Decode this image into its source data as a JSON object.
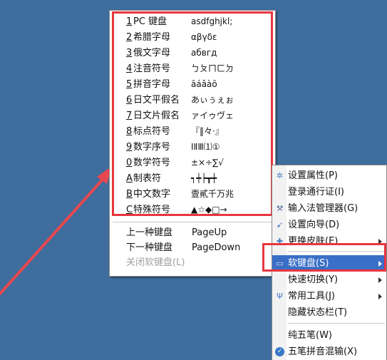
{
  "keyboard_menu": {
    "layouts": [
      {
        "key": "1",
        "label": "PC 键盘",
        "sample": "asdfghjkl;"
      },
      {
        "key": "2",
        "label": "希腊字母",
        "sample": "αβγδε"
      },
      {
        "key": "3",
        "label": "俄文字母",
        "sample": "абвгд"
      },
      {
        "key": "4",
        "label": "注音符号",
        "sample": "ㄅㄆㄇㄈㄉ"
      },
      {
        "key": "5",
        "label": "拼音字母",
        "sample": "āáǎàō"
      },
      {
        "key": "6",
        "label": "日文平假名",
        "sample": "あぃぅぇぉ"
      },
      {
        "key": "7",
        "label": "日文片假名",
        "sample": "ァイゥヴェ"
      },
      {
        "key": "8",
        "label": "标点符号",
        "sample": "『‖々·』"
      },
      {
        "key": "9",
        "label": "数字序号",
        "sample": "ⅠⅡⅢ⑴①"
      },
      {
        "key": "0",
        "label": "数学符号",
        "sample": "±×÷∑√"
      },
      {
        "key": "A",
        "label": "制表符",
        "sample": "┑┿┝┳┿"
      },
      {
        "key": "B",
        "label": "中文数字",
        "sample": "壹貳千万兆"
      },
      {
        "key": "C",
        "label": "特殊符号",
        "sample": "▲☆◆□→"
      }
    ],
    "commands": [
      {
        "label": "上一种键盘",
        "shortcut": "PageUp"
      },
      {
        "label": "下一种键盘",
        "shortcut": "PageDown"
      },
      {
        "label": "关闭软键盘(L)"
      }
    ]
  },
  "context_menu": {
    "items": [
      {
        "label": "设置属性(P)",
        "icon": "gear-icon"
      },
      {
        "label": "登录通行证(I)"
      },
      {
        "label": "输入法管理器(G)",
        "icon": "tools-icon"
      },
      {
        "label": "设置向导(D)",
        "icon": "wizard-icon"
      },
      {
        "label": "更换皮肤(E)",
        "icon": "skin-icon"
      },
      {
        "label": "软键盘(S)",
        "icon": "keyboard-icon"
      },
      {
        "label": "快速切换(Y)"
      },
      {
        "label": "常用工具(J)",
        "icon": "wrench-icon"
      },
      {
        "label": "隐藏状态栏(T)"
      },
      {
        "label": "纯五笔(W)"
      },
      {
        "label": "五笔拼音混输(X)",
        "icon": "check-icon"
      }
    ]
  },
  "colors": {
    "desktop": "#3f6d9d",
    "highlight_border": "#e8363f",
    "selection": "#3a6fc7",
    "arrow": "#e8474f"
  }
}
